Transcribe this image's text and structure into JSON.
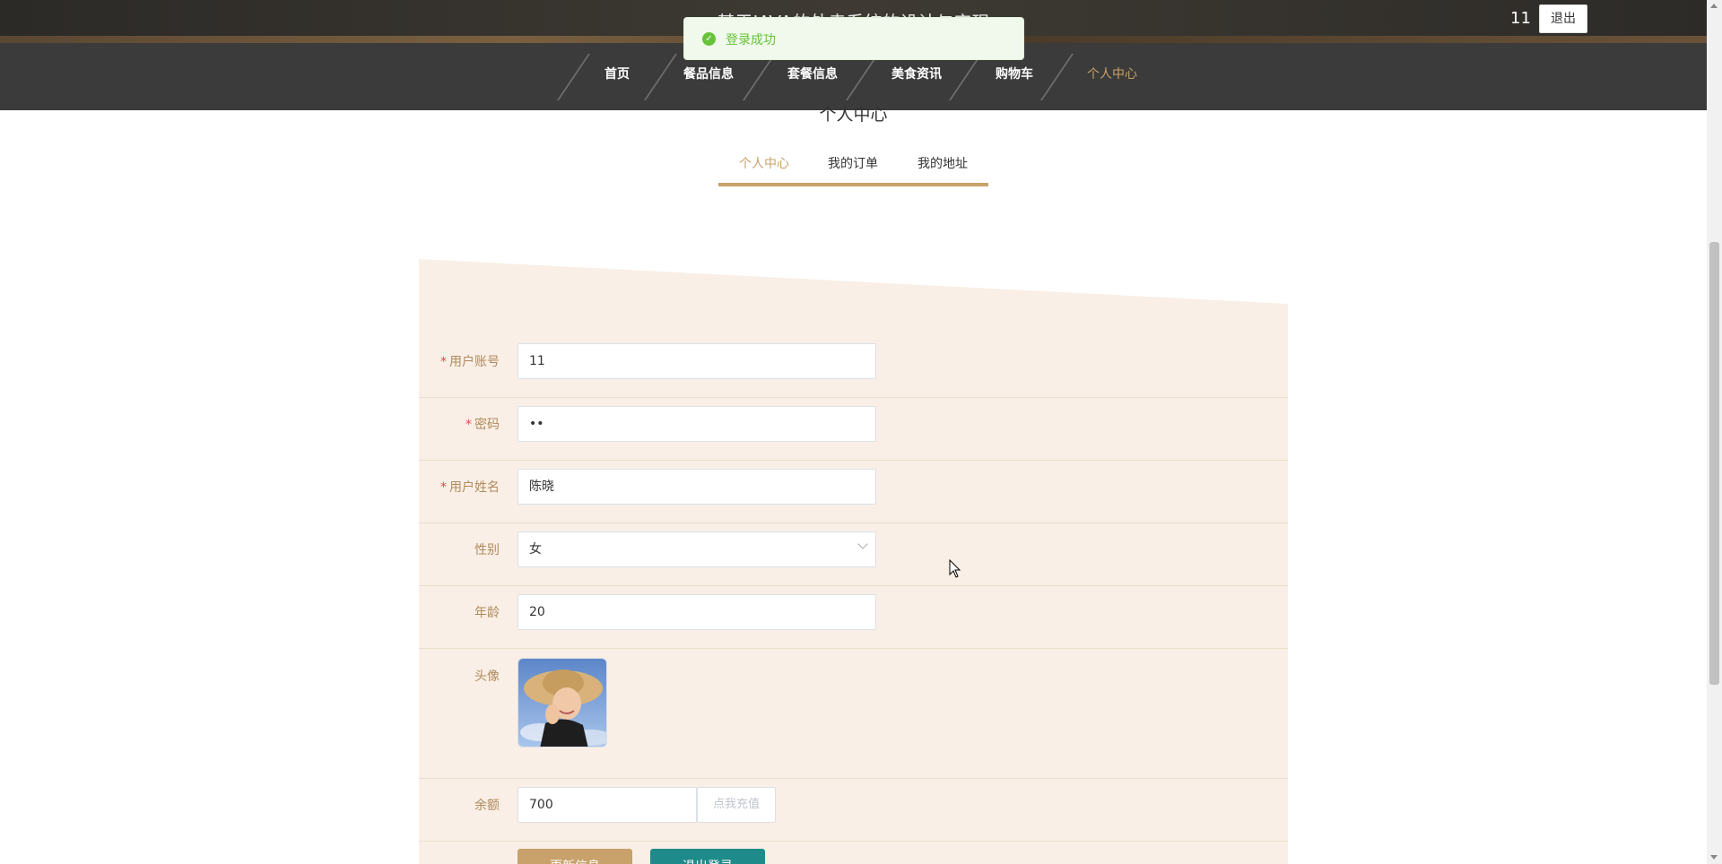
{
  "header": {
    "site_title": "基于JAVA的外卖系统的设计与实现",
    "user_name": "11",
    "logout_label": "退出"
  },
  "nav": {
    "items": [
      {
        "label": "首页"
      },
      {
        "label": "餐品信息"
      },
      {
        "label": "套餐信息"
      },
      {
        "label": "美食资讯"
      },
      {
        "label": "购物车"
      },
      {
        "label": "个人中心"
      }
    ],
    "active_index": 5
  },
  "toast": {
    "message": "登录成功",
    "icon": "check-circle-icon",
    "type": "success"
  },
  "page": {
    "section_title": "个人中心",
    "tabs": [
      {
        "label": "个人中心"
      },
      {
        "label": "我的订单"
      },
      {
        "label": "我的地址"
      }
    ],
    "active_tab": 0
  },
  "form": {
    "account": {
      "label": "用户账号",
      "value": "11",
      "required": true
    },
    "password": {
      "label": "密码",
      "value": "••",
      "required": true
    },
    "name": {
      "label": "用户姓名",
      "value": "陈晓",
      "required": true
    },
    "gender": {
      "label": "性别",
      "value": "女"
    },
    "age": {
      "label": "年龄",
      "value": "20"
    },
    "avatar": {
      "label": "头像"
    },
    "balance": {
      "label": "余额",
      "value": "700",
      "recharge_label": "点我充值"
    }
  },
  "actions": {
    "update_label": "更新信息",
    "logout_label": "退出登录"
  },
  "colors": {
    "accent": "#c9a16a",
    "panel_bg": "#f9efe6",
    "header_bg": "#3b3b3b",
    "teal": "#1f8a8a",
    "success": "#67c23a"
  }
}
